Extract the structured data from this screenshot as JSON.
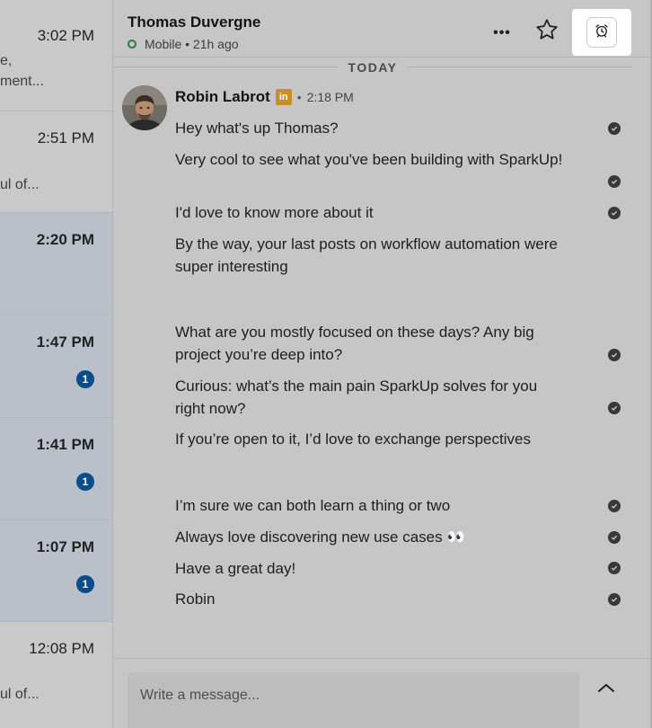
{
  "conversations": [
    {
      "time": "3:02 PM",
      "snippet_1": "e,",
      "snippet_2": "ment...",
      "unread": false,
      "badge": ""
    },
    {
      "time": "2:51 PM",
      "snippet_1": "ul of...",
      "snippet_2": "",
      "unread": false,
      "badge": ""
    },
    {
      "time": "2:20 PM",
      "snippet_1": "",
      "snippet_2": "",
      "unread": true,
      "badge": ""
    },
    {
      "time": "1:47 PM",
      "snippet_1": "",
      "snippet_2": "",
      "unread": true,
      "badge": "1"
    },
    {
      "time": "1:41 PM",
      "snippet_1": "",
      "snippet_2": "",
      "unread": true,
      "badge": "1"
    },
    {
      "time": "1:07 PM",
      "snippet_1": "",
      "snippet_2": "",
      "unread": true,
      "badge": "1"
    },
    {
      "time": "12:08 PM",
      "snippet_1": "ul of...",
      "snippet_2": "",
      "unread": false,
      "badge": ""
    }
  ],
  "header": {
    "name": "Thomas Duvergne",
    "status": "Mobile • 21h ago",
    "more_label": "•••"
  },
  "day_divider": "TODAY",
  "sender": {
    "name": "Robin Labrot",
    "badge": "in",
    "separator": "•",
    "time": "2:18 PM"
  },
  "messages": [
    {
      "text": "Hey what's up Thomas?",
      "read": true
    },
    {
      "text": "Very cool to see what you've been building with SparkUp!",
      "read": true
    },
    {
      "text": "I'd love to know more about it",
      "read": true
    },
    {
      "text": "By the way, your last posts on workflow automation were super interesting",
      "read": false
    },
    {
      "text": "What are you mostly focused on these days? Any big project you’re deep into?",
      "read": true
    },
    {
      "text": "Curious: what’s the main pain SparkUp solves for you right now?",
      "read": true
    },
    {
      "text": "If you’re open to it, I’d love to exchange perspectives",
      "read": false
    },
    {
      "text": " I’m sure we can both learn a thing or two",
      "read": true
    },
    {
      "text": "Always love discovering new use cases 👀",
      "read": true
    },
    {
      "text": "Have a great day!",
      "read": true
    },
    {
      "text": "Robin",
      "read": true
    }
  ],
  "composer": {
    "placeholder": "Write a message..."
  },
  "colors": {
    "unread_row": "#b9c0c9",
    "badge": "#0a4d8a",
    "online": "#2d7a3e",
    "linkedin_badge": "#c98d2b"
  },
  "icons": [
    "more-icon",
    "star-icon",
    "alarm-clock-icon",
    "read-receipt-icon",
    "chevron-up-icon"
  ]
}
